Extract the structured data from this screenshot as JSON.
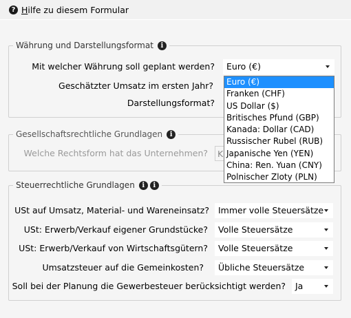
{
  "help": {
    "label_prefix": "H",
    "label_rest": "ilfe zu diesem Formular"
  },
  "sections": {
    "currency": {
      "title": "Währung und Darstellungsformat",
      "rows": [
        {
          "question": "Mit welcher Währung soll geplant werden?",
          "value": "Euro (€)"
        },
        {
          "question": "Geschätzter Umsatz im ersten Jahr?",
          "value": ""
        },
        {
          "question": "Darstellungsformat?",
          "value": ""
        }
      ]
    },
    "legal": {
      "title": "Gesellschaftsrechtliche Grundlagen",
      "rows": [
        {
          "question": "Welche Rechtsform hat das Unternehmen?",
          "value": "K"
        }
      ]
    },
    "tax": {
      "title": "Steuerrechtliche Grundlagen",
      "rows": [
        {
          "question": "USt auf Umsatz, Material- und Wareneinsatz?",
          "value": "Immer volle Steuersätze"
        },
        {
          "question": "USt: Erwerb/Verkauf eigener Grundstücke?",
          "value": "Volle Steuersätze"
        },
        {
          "question": "USt: Erwerb/Verkauf von Wirtschaftsgütern?",
          "value": "Volle Steuersätze"
        },
        {
          "question": "Umsatzsteuer auf die Gemeinkosten?",
          "value": "Übliche Steuersätze"
        },
        {
          "question": "Soll bei der Planung die Gewerbesteuer berücksichtigt werden?",
          "value": "Ja"
        }
      ]
    }
  },
  "currency_dropdown": {
    "selected_index": 0,
    "options": [
      "Euro (€)",
      "Franken (CHF)",
      "US Dollar ($)",
      "Britisches Pfund (GBP)",
      "Kanada: Dollar (CAD)",
      "Russischer Rubel (RUB)",
      "Japanische Yen (YEN)",
      "China: Ren. Yuan (CNY)",
      "Polnischer Zloty (PLN)"
    ]
  }
}
